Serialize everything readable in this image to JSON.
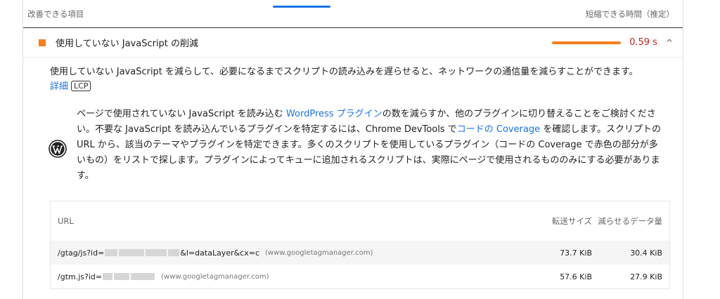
{
  "header": {
    "left_label": "改善できる項目",
    "right_label": "短縮できる時間（推定）"
  },
  "audit": {
    "title": "使用していない JavaScript の削減",
    "savings": "0.59 s",
    "expand_icon": "chevron-up-icon",
    "accent_color": "#fa7e1e",
    "savings_color": "#c5221f"
  },
  "description": {
    "text": "使用していない JavaScript を減らして、必要になるまでスクリプトの読み込みを遅らせると、ネットワークの通信量を減らすことができます。",
    "learn_more": "詳細",
    "badge": "LCP"
  },
  "stack_pack": {
    "icon": "wordpress-icon",
    "p1": "ページで使用されていない JavaScript を読み込む ",
    "link1": "WordPress プラグイン",
    "p2": "の数を減らすか、他のプラグインに切り替えることをご検討ください。不要な JavaScript を読み込んでいるプラグインを特定するには、Chrome DevTools で",
    "link2": "コードの Coverage",
    "p3": " を確認します。スクリプトの URL から、該当のテーマやプラグインを特定できます。多くのスクリプトを使用しているプラグイン（コードの Coverage で赤色の部分が多いもの）をリストで探します。プラグインによってキューに追加されるスクリプトは、実際にページで使用されるもののみにする必要があります。"
  },
  "table": {
    "headers": {
      "url": "URL",
      "size": "転送サイズ",
      "savings": "減らせるデータ量"
    },
    "rows": [
      {
        "url_prefix": "/gtag/js?id=",
        "url_suffix": "&l=dataLayer&cx=c",
        "host": "(www.googletagmanager.com)",
        "size": "73.7 KiB",
        "savings": "30.4 KiB"
      },
      {
        "url_prefix": "/gtm.js?id=",
        "url_suffix": "",
        "host": "(www.googletagmanager.com)",
        "size": "57.6 KiB",
        "savings": "27.9 KiB"
      }
    ]
  }
}
